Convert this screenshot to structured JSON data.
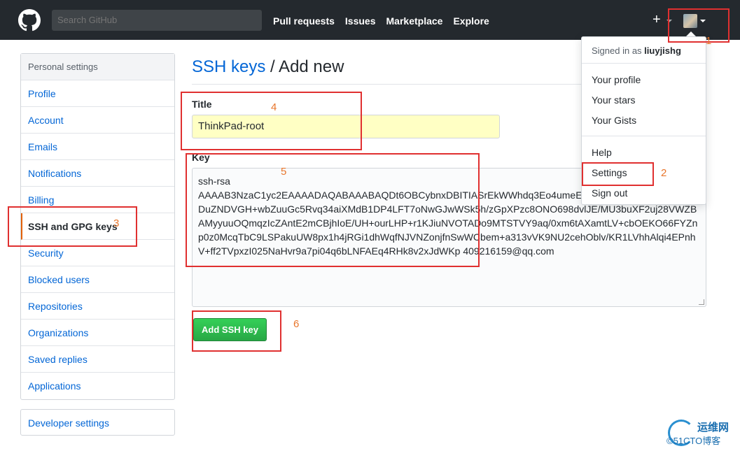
{
  "header": {
    "search_placeholder": "Search GitHub",
    "nav": [
      "Pull requests",
      "Issues",
      "Marketplace",
      "Explore"
    ],
    "plus_label": "+"
  },
  "sidebar": {
    "heading": "Personal settings",
    "items": [
      {
        "label": "Profile"
      },
      {
        "label": "Account"
      },
      {
        "label": "Emails"
      },
      {
        "label": "Notifications"
      },
      {
        "label": "Billing"
      },
      {
        "label": "SSH and GPG keys"
      },
      {
        "label": "Security"
      },
      {
        "label": "Blocked users"
      },
      {
        "label": "Repositories"
      },
      {
        "label": "Organizations"
      },
      {
        "label": "Saved replies"
      },
      {
        "label": "Applications"
      }
    ],
    "developer": "Developer settings"
  },
  "main": {
    "breadcrumb_link": "SSH keys",
    "breadcrumb_rest": " / Add new",
    "title_label": "Title",
    "title_value": "ThinkPad-root",
    "key_label": "Key",
    "key_value": "ssh-rsa\nAAAAB3NzaC1yc2EAAAADAQABAAABAQDt6OBCybnxDBITIASrEkWWhdq3Eo4umeEJ6LWEzOBVn3ZM4uzM/DDuZNDVGH+wbZuuGc5Rvq34aiXMdB1DP4LFT7oNwGJwWSk5h/zGpXPzc8ONO698dvlJE/MU3buXF2uj28VWZBAMyyuuOQmqzIcZAntE2mCBjhIoE/UH+ourLHP+r1KJiuNVOTADo9MTSTVY9aq/0xm6tAXamtLV+cbOEKO66FYZnp0z0McqTbC9LSPakuUW8px1h4jRGi1dhWqfNJVNZonjfnSwWCbem+a313vVK9NU2cehOblv/KR1LVhhAlqi4EPnhV+ff2TVpxzI025NaHvr9a7pi04q6bLNFAEq4RHk8v2xJdWKp 409216159@qq.com",
    "button": "Add SSH key"
  },
  "dropdown": {
    "signed_prefix": "Signed in as ",
    "username": "liuyjishg",
    "items": [
      "Your profile",
      "Your stars",
      "Your Gists",
      "Help",
      "Settings",
      "Sign out"
    ]
  },
  "annotations": [
    "1",
    "2",
    "3",
    "4",
    "5",
    "6"
  ],
  "watermark": {
    "top": "运维网",
    "bottom": "©51CTO博客"
  },
  "colors": {
    "header_bg": "#24292e",
    "link": "#0366d6",
    "annotation": "#e03030",
    "button": "#28a745",
    "title_input_bg": "#ffffc4"
  }
}
